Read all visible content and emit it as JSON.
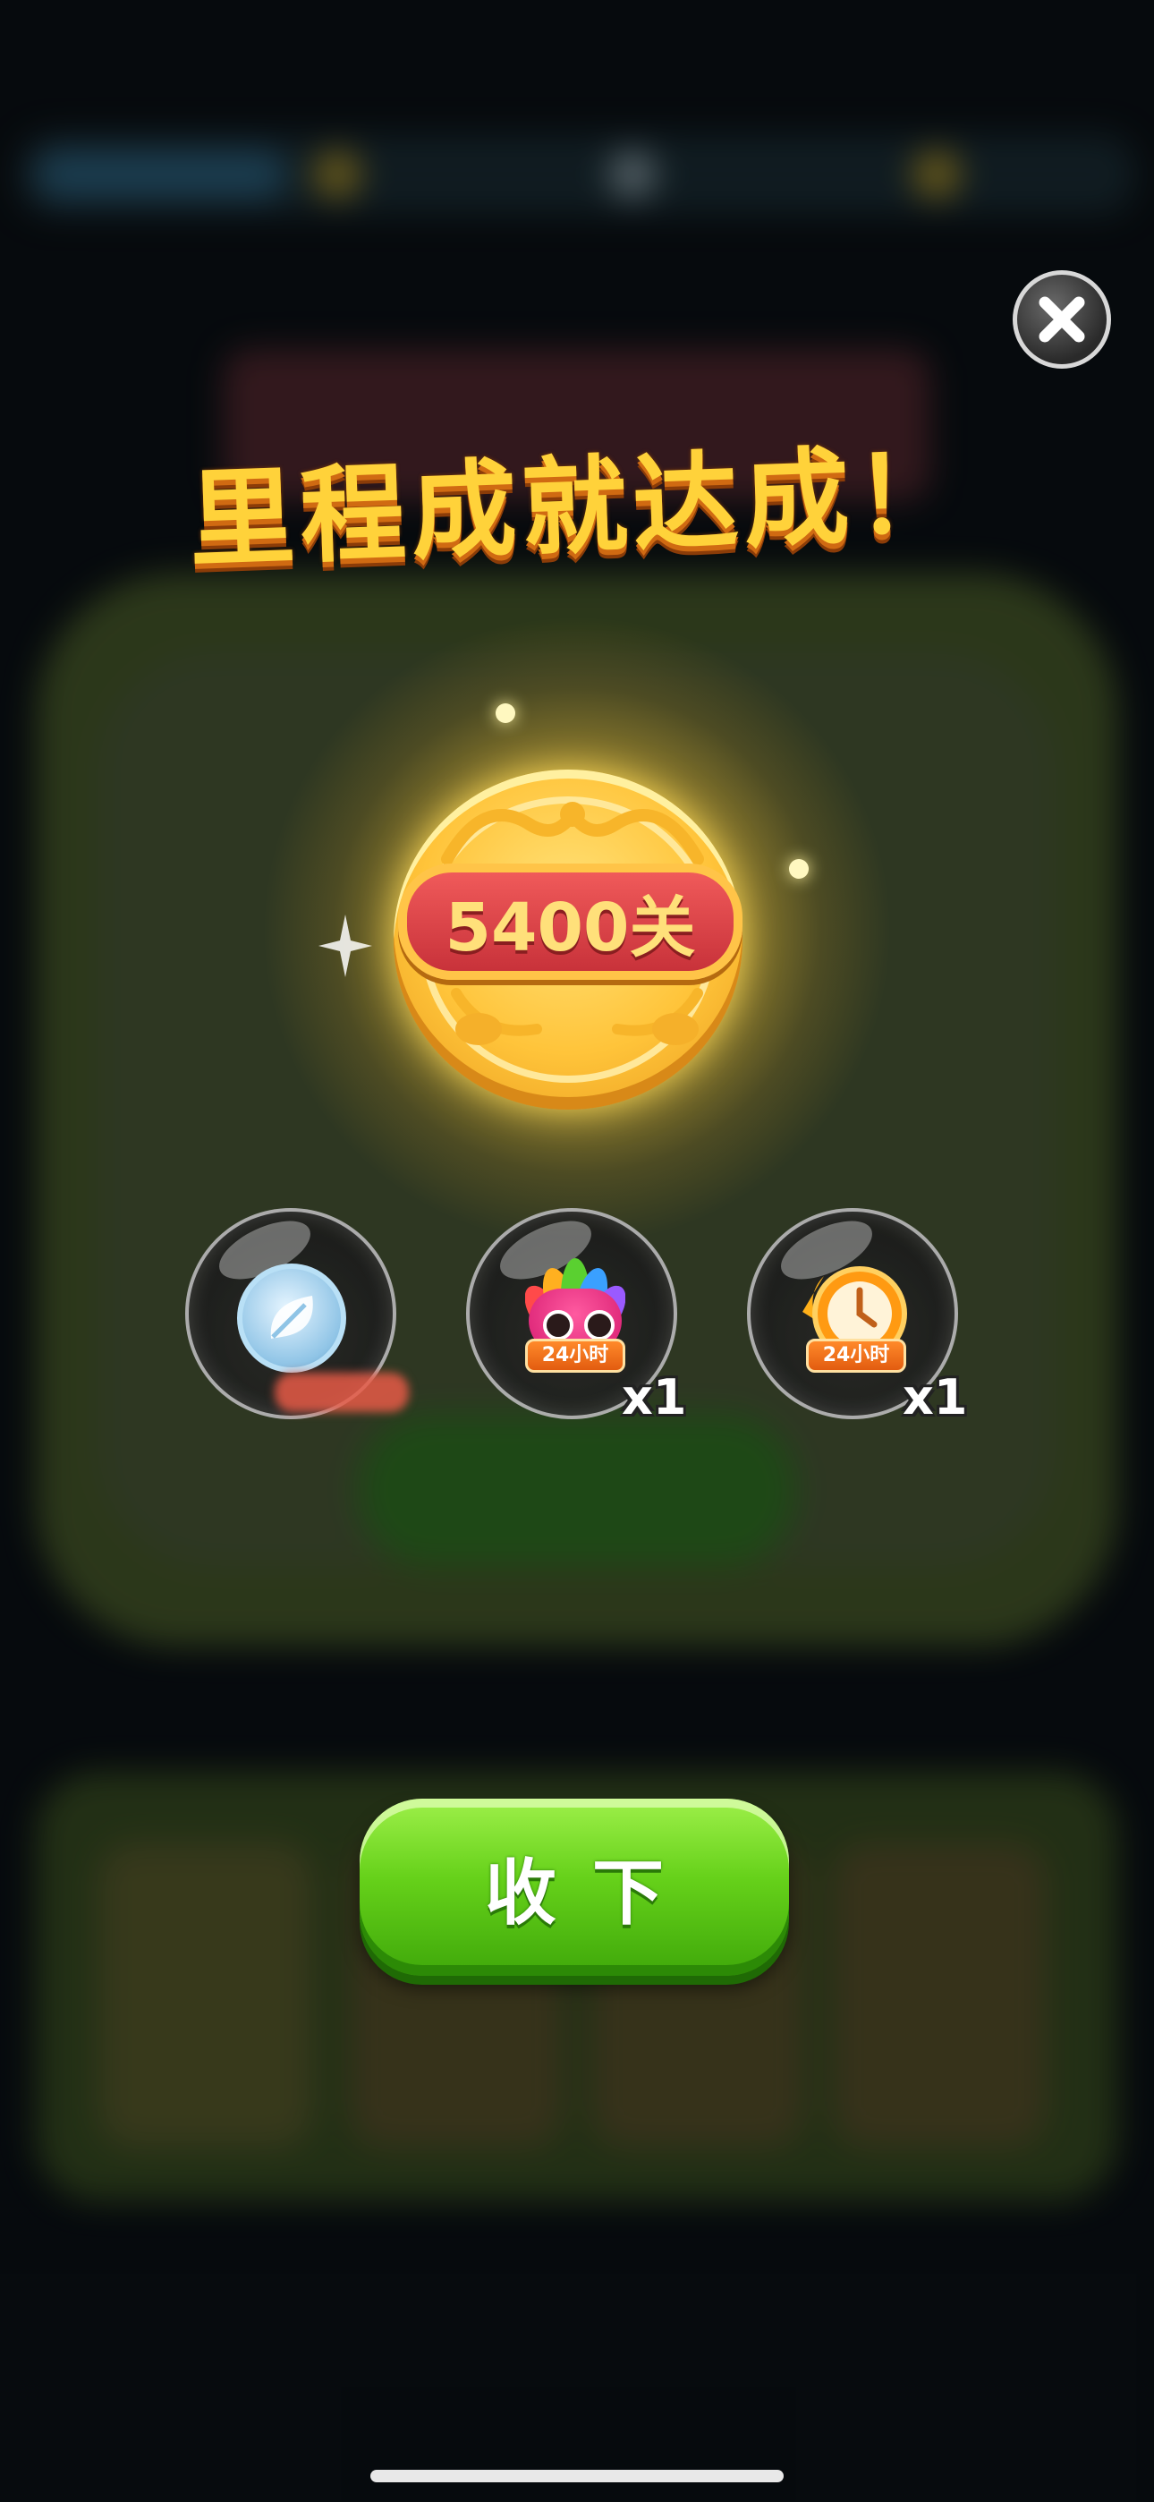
{
  "title": "里程成就达成！",
  "medal": {
    "label": "5400关"
  },
  "rewards": [
    {
      "name": "coin",
      "icon": "leaf-coin-icon",
      "quantity": ""
    },
    {
      "name": "parrot-booster",
      "icon": "rainbow-parrot-icon",
      "duration": "24小时",
      "quantity": "x1"
    },
    {
      "name": "clock-booster",
      "icon": "clock-icon",
      "duration": "24小时",
      "quantity": "x1"
    }
  ],
  "collect_button": {
    "label": "收下"
  },
  "close_button": {
    "icon": "close-icon"
  },
  "colors": {
    "title": "#ffd23a",
    "button_green": "#66d11a",
    "medal_gold": "#ffc43a",
    "banner_red": "#d83a40"
  }
}
